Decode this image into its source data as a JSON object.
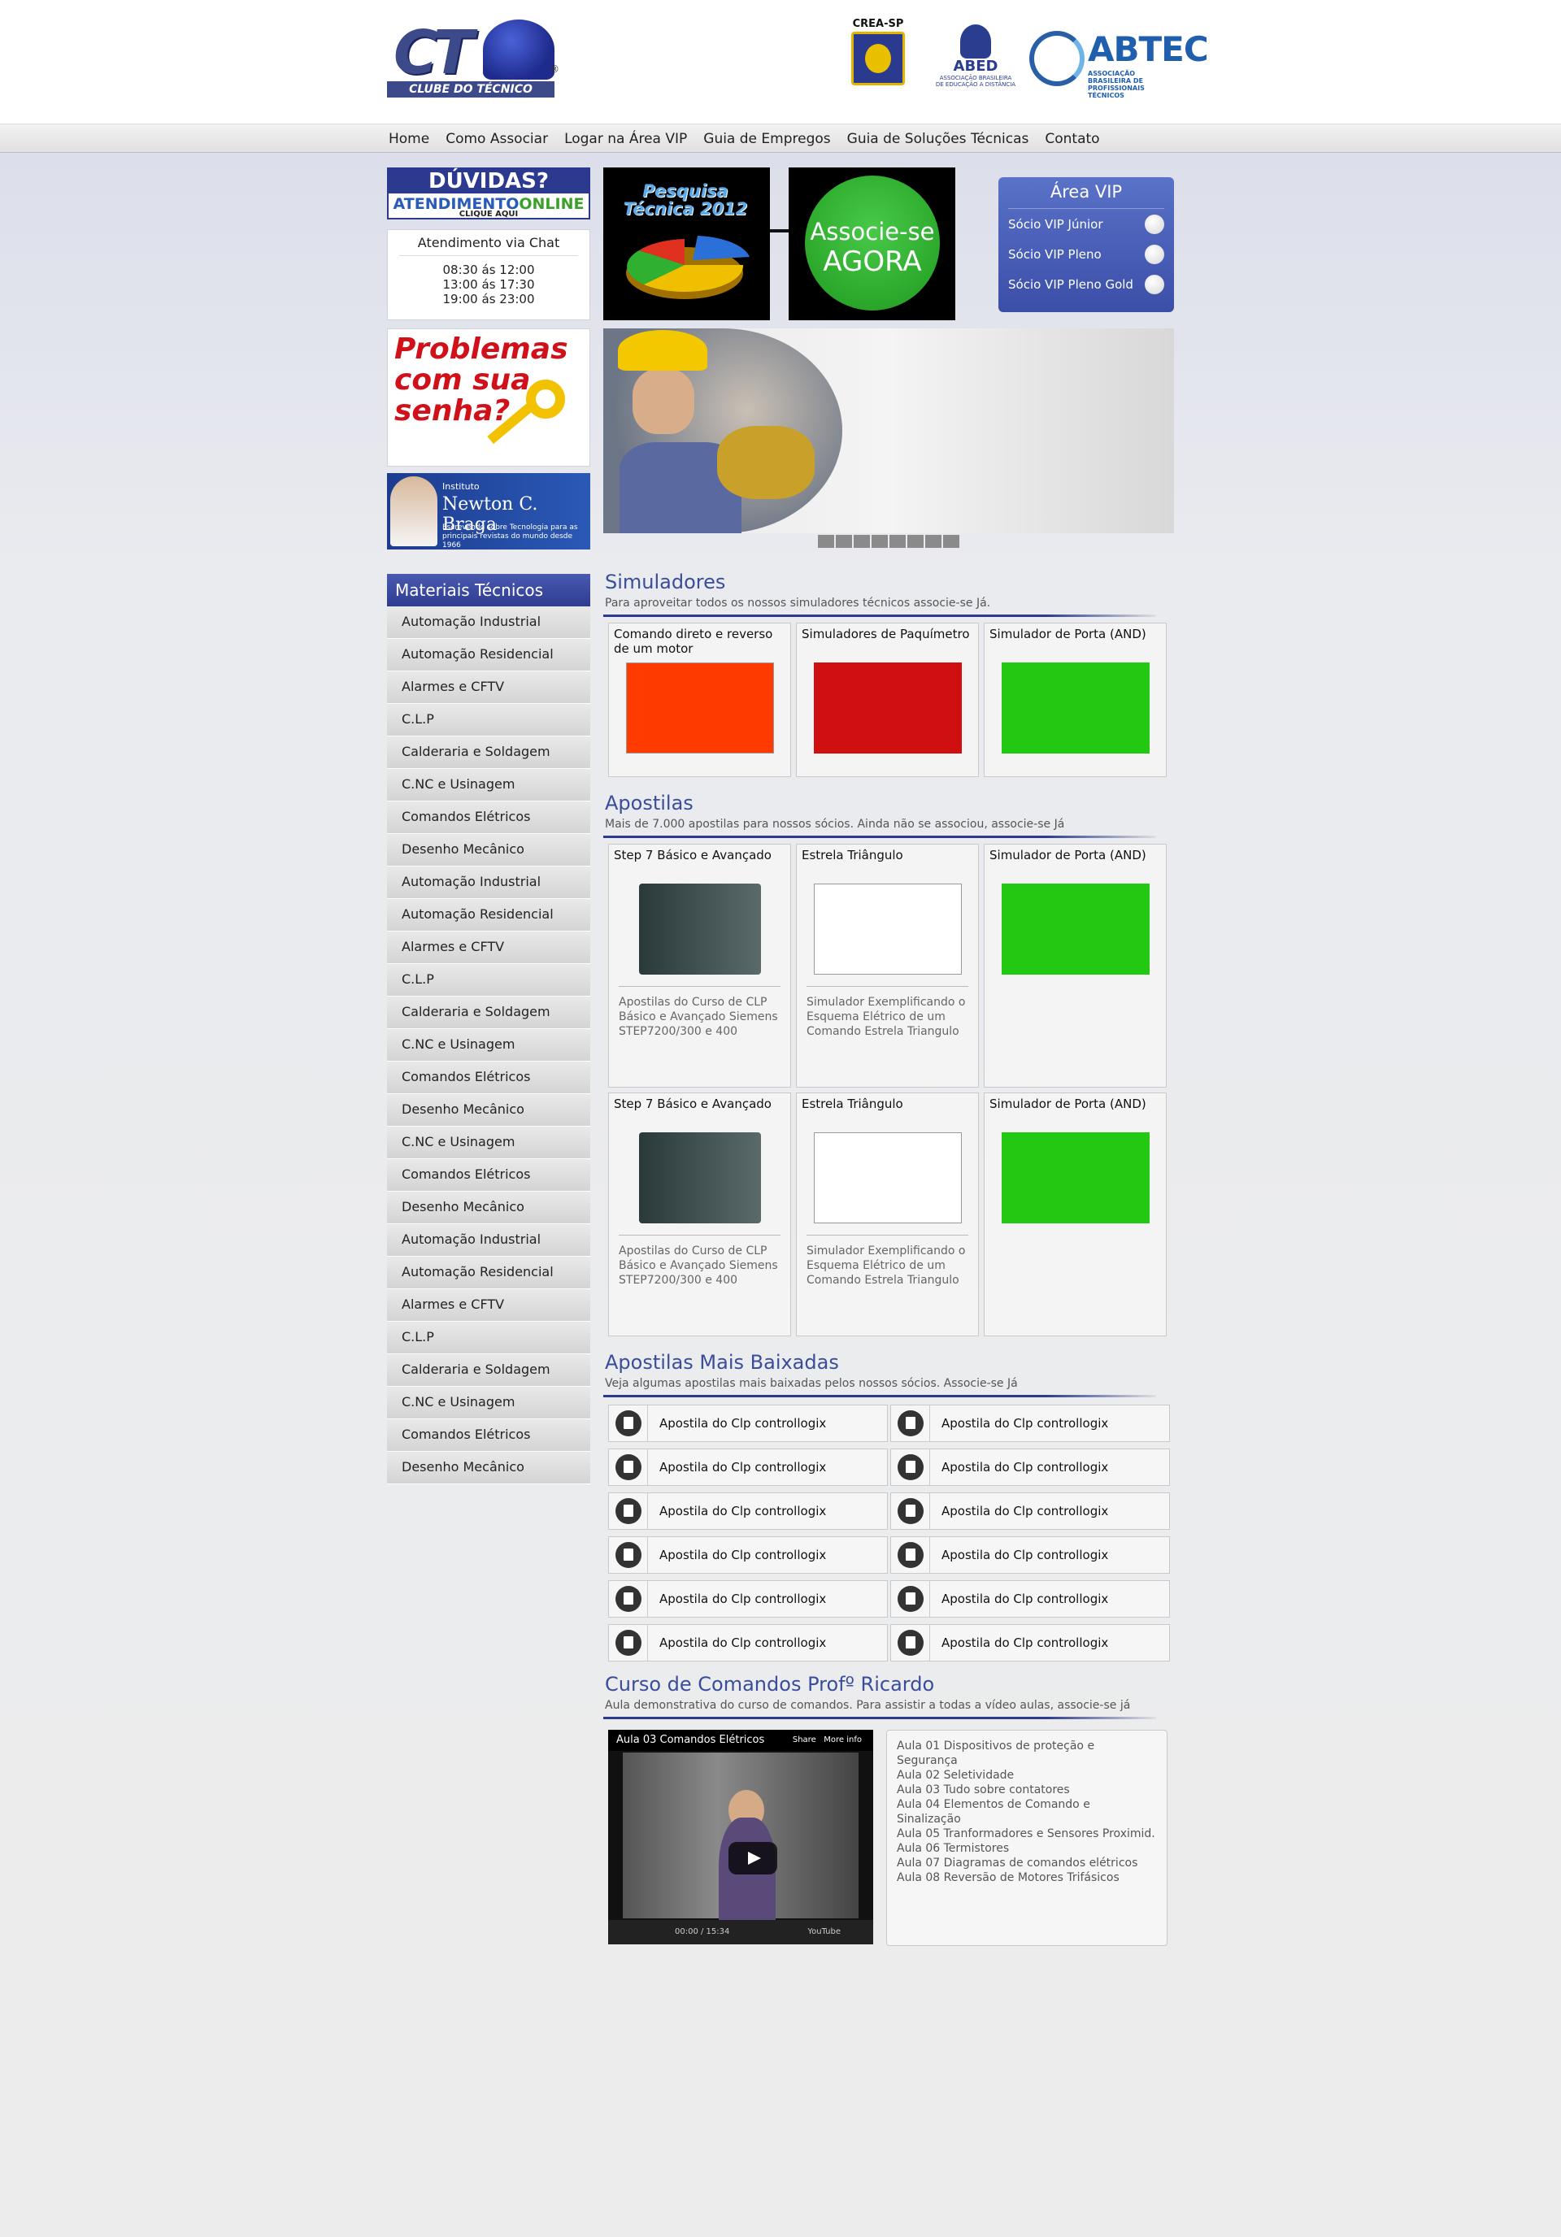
{
  "header": {
    "logo_text": "CT",
    "logo_band": "CLUBE DO TÉCNICO",
    "logo_mark": "®",
    "crea": "CREA-SP",
    "abed": "ABED",
    "abed_desc": "ASSOCIAÇÃO BRASILEIRA DE EDUCAÇÃO A DISTÂNCIA",
    "abtec": "ABTEC",
    "abtec_desc": "ASSOCIAÇÃO BRASILEIRA DE PROFISSIONAIS TÉCNICOS"
  },
  "nav": [
    "Home",
    "Como Associar",
    "Logar na Área VIP",
    "Guia de Empregos",
    "Guia de Soluções Técnicas",
    "Contato"
  ],
  "sidebar": {
    "duvidas": {
      "title": "DÚVIDAS?",
      "line1": "ATENDIMENTO",
      "line1_b": "ONLINE",
      "line2": "CLIQUE AQUI"
    },
    "chat": {
      "title": "Atendimento via Chat",
      "hours": [
        "08:30 ás 12:00",
        "13:00 ás 17:30",
        "19:00 ás 23:00"
      ]
    },
    "senha": "Problemas com sua senha?",
    "newton": {
      "inst": "Instituto",
      "name": "Newton  C. Braga",
      "desc": "Escrevendo sobre Tecnologia para as principais revistas do mundo desde 1966"
    },
    "menu_title": "Materiais Técnicos",
    "menu": [
      "Automação Industrial",
      "Automação Residencial",
      "Alarmes e CFTV",
      "C.L.P",
      "Calderaria e Soldagem",
      "C.NC e Usinagem",
      "Comandos Elétricos",
      "Desenho Mecânico",
      "Automação Industrial",
      "Automação Residencial",
      "Alarmes e CFTV",
      "C.L.P",
      "Calderaria e Soldagem",
      "C.NC e Usinagem",
      "Comandos Elétricos",
      "Desenho Mecânico",
      "C.NC e Usinagem",
      "Comandos Elétricos",
      "Desenho Mecânico",
      "Automação Industrial",
      "Automação Residencial",
      "Alarmes e CFTV",
      "C.L.P",
      "Calderaria e Soldagem",
      "C.NC e Usinagem",
      "Comandos Elétricos",
      "Desenho Mecânico"
    ]
  },
  "promo": {
    "pesquisa": "Pesquisa Técnica 2012",
    "associe1": "Associe-se",
    "associe2": "AGORA"
  },
  "vip": {
    "title": "Área VIP",
    "items": [
      "Sócio VIP Júnior",
      "Sócio VIP Pleno",
      "Sócio VIP Pleno Gold"
    ]
  },
  "simuladores": {
    "title": "Simuladores",
    "sub": "Para aproveitar todos os nossos simuladores técnicos associe-se Já.",
    "cards": [
      {
        "title": "Comando direto e reverso de um motor"
      },
      {
        "title": "Simuladores de Paquímetro"
      },
      {
        "title": "Simulador de Porta (AND)"
      }
    ]
  },
  "apostilas": {
    "title": "Apostilas",
    "sub": "Mais de 7.000 apostilas para nossos sócios. Ainda não se associou, associe-se Já",
    "cards": [
      {
        "title": "Step 7 Básico e Avançado",
        "desc": "Apostilas do Curso de CLP Básico e Avançado Siemens STEP7200/300 e 400"
      },
      {
        "title": "Estrela Triângulo",
        "desc": "Simulador Exemplificando o Esquema Elétrico de um Comando Estrela Triangulo"
      },
      {
        "title": "Simulador de Porta (AND)",
        "desc": ""
      },
      {
        "title": "Step 7 Básico e Avançado",
        "desc": "Apostilas do Curso de CLP Básico e Avançado Siemens STEP7200/300 e 400"
      },
      {
        "title": "Estrela Triângulo",
        "desc": "Simulador Exemplificando o Esquema Elétrico de um Comando Estrela Triangulo"
      },
      {
        "title": "Simulador de Porta (AND)",
        "desc": ""
      }
    ]
  },
  "mais_baixadas": {
    "title": "Apostilas Mais Baixadas",
    "sub": "Veja algumas apostilas mais baixadas pelos nossos sócios. Associe-se Já",
    "items": [
      "Apostila do Clp controllogix",
      "Apostila do Clp controllogix",
      "Apostila do Clp controllogix",
      "Apostila do Clp controllogix",
      "Apostila do Clp controllogix",
      "Apostila do Clp controllogix",
      "Apostila do Clp controllogix",
      "Apostila do Clp controllogix",
      "Apostila do Clp controllogix",
      "Apostila do Clp controllogix",
      "Apostila do Clp controllogix",
      "Apostila do Clp controllogix"
    ]
  },
  "curso": {
    "title": "Curso de Comandos Profº Ricardo",
    "sub": "Aula demonstrativa do curso de comandos. Para assistir a todas a vídeo aulas, associe-se já",
    "video_title": "Aula 03 Comandos Elétricos",
    "share": "Share",
    "more": "More info",
    "time": "00:00 / 15:34",
    "yt": "YouTube",
    "lessons": [
      "Aula 01 Dispositivos de proteção e Segurança",
      "Aula 02 Seletividade",
      "Aula 03 Tudo sobre contatores",
      "Aula 04 Elementos de Comando e Sinalização",
      "Aula 05 Tranformadores e Sensores Proximid.",
      "Aula 06 Termistores",
      "Aula 07 Diagramas de comandos elétricos",
      "Aula 08 Reversão de Motores Trifásicos"
    ]
  }
}
